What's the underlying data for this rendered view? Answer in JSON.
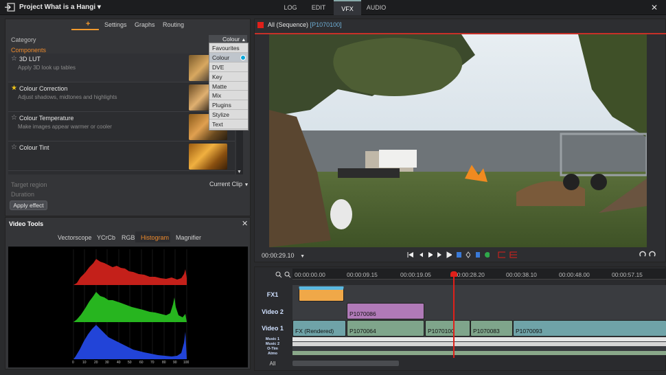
{
  "header": {
    "title": "Project What is a Hangi",
    "title_caret": "▾",
    "tabs": [
      "LOG",
      "EDIT",
      "VFX",
      "AUDIO"
    ],
    "active_tab": "VFX",
    "close": "✕"
  },
  "effects": {
    "sub_tabs": {
      "plus": "+",
      "settings": "Settings",
      "graphs": "Graphs",
      "routing": "Routing"
    },
    "category_label": "Category",
    "category_value": "Colour",
    "category_caret": "▲",
    "components_label": "Components",
    "items": [
      {
        "name": "3D LUT",
        "desc": "Apply 3D look up tables",
        "fav": false
      },
      {
        "name": "Colour Correction",
        "desc": "Adjust shadows, midtones and highlights",
        "fav": true
      },
      {
        "name": "Colour Temperature",
        "desc": "Make images appear warmer or cooler",
        "fav": false
      },
      {
        "name": "Colour Tint",
        "desc": "",
        "fav": false
      }
    ],
    "dropdown": [
      "Favourites",
      "Colour",
      "DVE",
      "Key",
      "Matte",
      "Mix",
      "Plugins",
      "Stylize",
      "Text"
    ],
    "target_label": "Target region",
    "target_value": "Current Clip",
    "target_caret": "▼",
    "duration_label": "Duration",
    "apply_label": "Apply effect",
    "scroll_down": "▼"
  },
  "video_tools": {
    "title": "Video Tools",
    "close": "✕",
    "tabs": [
      "Vectorscope",
      "YCrCb",
      "RGB",
      "Histogram",
      "Magnifier"
    ],
    "active": "Histogram",
    "hist_axis": [
      "0",
      "10",
      "20",
      "30",
      "40",
      "50",
      "60",
      "70",
      "80",
      "90",
      "100"
    ]
  },
  "viewer": {
    "title": "All (Sequence)",
    "clip": "[P1070100]",
    "timecode": "00:00:29.10",
    "tc_caret": "▼"
  },
  "timeline": {
    "ruler": [
      "00:00:00.00",
      "00:00:09.15",
      "00:00:19.05",
      "00:00:28.20",
      "00:00:38.10",
      "00:00:48.00",
      "00:00:57.15"
    ],
    "tracks": {
      "fx1": "FX1",
      "v2": "Video 2",
      "v1": "Video 1",
      "m1": "Music 1",
      "m2": "Music 2",
      "ot": "O-Tim",
      "atmo": "Atmo",
      "all": "All"
    },
    "clips": {
      "v2a": "P1070086",
      "v1a": "FX (Rendered)",
      "v1b": "P1070064",
      "v1c": "P1070100",
      "v1d": "P1070083",
      "v1e": "P1070093"
    }
  },
  "colors": {
    "accent": "#f39a2e",
    "playhead": "#e0201a",
    "video2": "#b07ab8",
    "video1": "#7fa58b",
    "fx": "#f0a848",
    "clip_teal": "#6fa3a8"
  }
}
